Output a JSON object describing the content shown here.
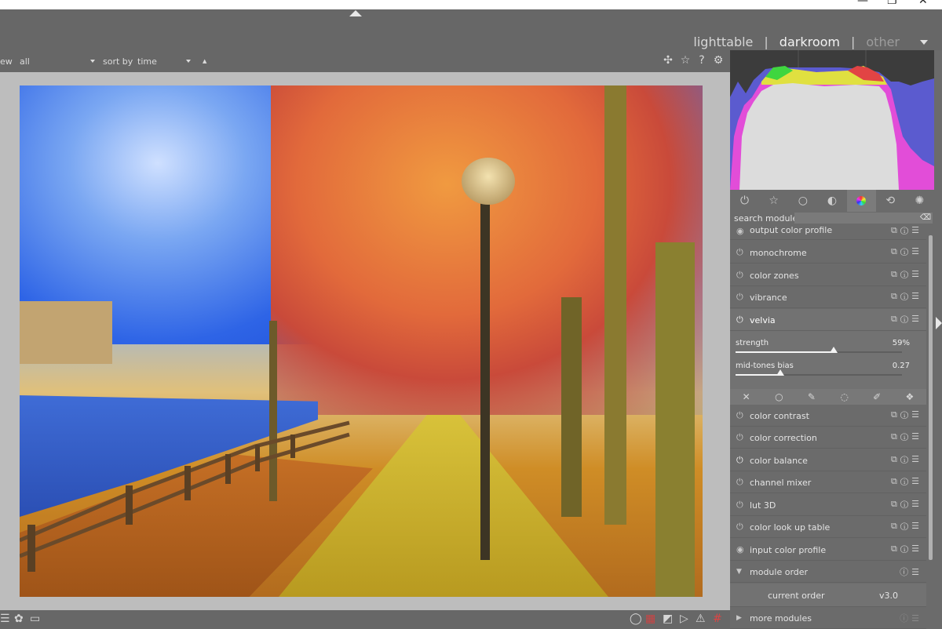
{
  "window": {
    "minimize": "—",
    "restore": "❐",
    "close": "✕"
  },
  "views": {
    "lighttable": "lighttable",
    "darkroom": "darkroom",
    "other": "other",
    "separator": "|"
  },
  "filter": {
    "view_label": "ew",
    "view_value": "all",
    "sort_label": "sort by",
    "sort_value": "time",
    "sort_dir": "▲"
  },
  "search": {
    "label": "search module",
    "value": ""
  },
  "modules": [
    {
      "name": "output color profile",
      "state": "off"
    },
    {
      "name": "monochrome",
      "state": "off"
    },
    {
      "name": "color zones",
      "state": "off"
    },
    {
      "name": "vibrance",
      "state": "off"
    },
    {
      "name": "velvia",
      "state": "on"
    },
    {
      "name": "color contrast",
      "state": "off"
    },
    {
      "name": "color correction",
      "state": "off"
    },
    {
      "name": "color balance",
      "state": "on"
    },
    {
      "name": "channel mixer",
      "state": "off"
    },
    {
      "name": "lut 3D",
      "state": "off"
    },
    {
      "name": "color look up table",
      "state": "off"
    },
    {
      "name": "input color profile",
      "state": "off"
    },
    {
      "name": "module order",
      "state": "group"
    },
    {
      "name": "more modules",
      "state": "group"
    }
  ],
  "velvia": {
    "strength": {
      "label": "strength",
      "value": "59%",
      "fraction": 0.59
    },
    "midtones": {
      "label": "mid-tones bias",
      "value": "0.27",
      "fraction": 0.27
    }
  },
  "order": {
    "label": "current order",
    "value": "v3.0"
  },
  "colors": {
    "accent": "#f2f2f2",
    "panel": "#6b6b6b",
    "center_bg": "#bdbdbd"
  }
}
